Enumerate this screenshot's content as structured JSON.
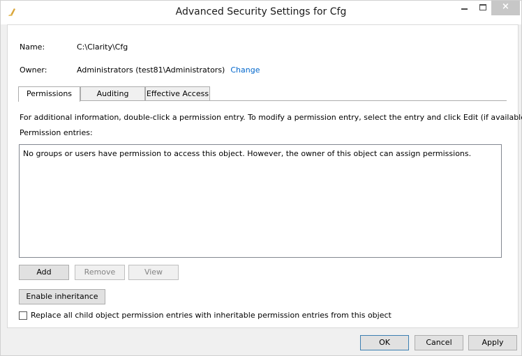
{
  "window": {
    "title": "Advanced Security Settings for Cfg",
    "close_glyph": "×"
  },
  "info": {
    "name_label": "Name:",
    "name_value": "C:\\Clarity\\Cfg",
    "owner_label": "Owner:",
    "owner_value": "Administrators (test81\\Administrators)",
    "change_link": "Change"
  },
  "tabs": [
    {
      "label": "Permissions",
      "active": true
    },
    {
      "label": "Auditing",
      "active": false
    },
    {
      "label": "Effective Access",
      "active": false
    }
  ],
  "permissions": {
    "description": "For additional information, double-click a permission entry. To modify a permission entry, select the entry and click Edit (if available).",
    "entries_label": "Permission entries:",
    "entries_message": "No groups or users have permission to access this object. However, the owner of this object can assign permissions.",
    "add_label": "Add",
    "remove_label": "Remove",
    "view_label": "View",
    "enable_inheritance_label": "Enable inheritance",
    "replace_checkbox_label": "Replace all child object permission entries with inheritable permission entries from this object",
    "replace_checked": false
  },
  "footer": {
    "ok_label": "OK",
    "cancel_label": "Cancel",
    "apply_label": "Apply"
  },
  "icons": {
    "title_icon": "folder-icon",
    "minimize": "minimize-icon",
    "maximize": "maximize-icon",
    "close": "close-icon"
  },
  "colors": {
    "link": "#0066cc",
    "close_button_bg": "#c7c7c7",
    "window_bg": "#f0f0f0"
  }
}
